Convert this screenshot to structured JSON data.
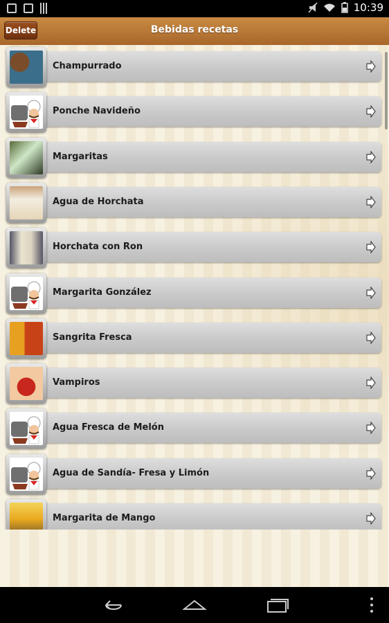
{
  "status_bar": {
    "time": "10:39"
  },
  "header": {
    "title": "Bebidas recetas",
    "delete_label": "Delete"
  },
  "recipes": [
    {
      "name": "Champurrado",
      "image": "champurrado-photo"
    },
    {
      "name": "Ponche Navideño",
      "image": "chef-icon"
    },
    {
      "name": "Margaritas",
      "image": "margaritas-photo"
    },
    {
      "name": "Agua de Horchata",
      "image": "horchata-photo"
    },
    {
      "name": "Horchata con Ron",
      "image": "horchata-ron-photo"
    },
    {
      "name": "Margarita González",
      "image": "chef-icon"
    },
    {
      "name": "Sangrita Fresca",
      "image": "sangrita-photo"
    },
    {
      "name": "Vampiros",
      "image": "vampiros-photo"
    },
    {
      "name": "Agua Fresca de Melón",
      "image": "chef-icon"
    },
    {
      "name": "Agua de Sandía- Fresa y Limón",
      "image": "chef-icon"
    },
    {
      "name": "Margarita de Mango",
      "image": "mango-photo"
    }
  ],
  "colors": {
    "header": "#b5733a",
    "row": "#cfcfcf"
  }
}
